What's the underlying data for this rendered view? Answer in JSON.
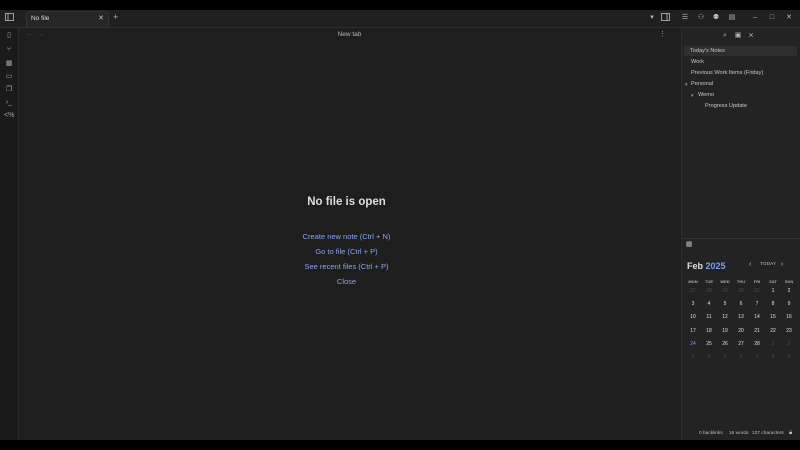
{
  "tabbar": {
    "tab_label": "No file",
    "close": "✕",
    "new_tab": "+",
    "icons": {
      "sidebar_left": "sidebar-left-icon",
      "chevron": "chevron-down-icon",
      "sidebar_right": "sidebar-right-icon"
    }
  },
  "window": {
    "minimize": "–",
    "maximize": "□",
    "close": "✕"
  },
  "pane": {
    "back": "←",
    "forward": "→",
    "title": "New tab",
    "more": "⋮"
  },
  "empty": {
    "title": "No file is open",
    "actions": [
      "Create new note (Ctrl + N)",
      "Go to file (Ctrl + P)",
      "See recent files (Ctrl + P)",
      "Close"
    ]
  },
  "sidebar": {
    "notes": [
      {
        "label": "Today's Notes"
      },
      {
        "label": "Work"
      },
      {
        "label": "Previous Work Items (Friday)"
      },
      {
        "label": "Personal"
      },
      {
        "label": "Wemo"
      },
      {
        "label": "Progress Update"
      }
    ]
  },
  "calendar": {
    "month": "Feb",
    "year": "2025",
    "today_label": "TODAY",
    "prev": "‹",
    "next": "›",
    "weekdays": [
      "MON",
      "TUE",
      "WED",
      "THU",
      "FRI",
      "SAT",
      "SUN"
    ],
    "weeks": [
      [
        "27",
        "28",
        "29",
        "30",
        "31",
        "1",
        "2"
      ],
      [
        "3",
        "4",
        "5",
        "6",
        "7",
        "8",
        "9"
      ],
      [
        "10",
        "11",
        "12",
        "13",
        "14",
        "15",
        "16"
      ],
      [
        "17",
        "18",
        "19",
        "20",
        "21",
        "22",
        "23"
      ],
      [
        "24",
        "25",
        "26",
        "27",
        "28",
        "1",
        "2"
      ],
      [
        "3",
        "4",
        "5",
        "6",
        "7",
        "8",
        "9"
      ]
    ]
  },
  "status": {
    "backlinks": "0 backlinks",
    "words": "16 words",
    "characters": "137 characters"
  }
}
